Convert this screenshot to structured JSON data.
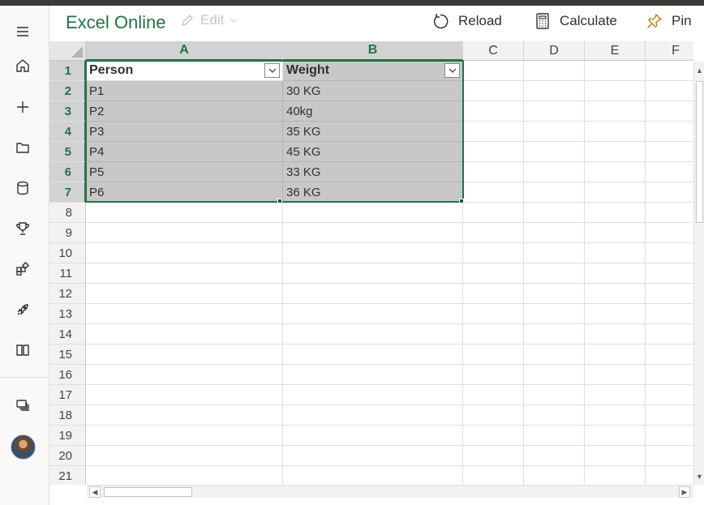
{
  "app": {
    "title": "Excel Online",
    "edit_label": "Edit"
  },
  "toolbar": {
    "reload_label": "Reload",
    "calculate_label": "Calculate",
    "pin_label": "Pin"
  },
  "rail": {
    "items": [
      {
        "name": "menu-icon"
      },
      {
        "name": "home-icon"
      },
      {
        "name": "new-icon"
      },
      {
        "name": "folder-icon"
      },
      {
        "name": "database-icon"
      },
      {
        "name": "trophy-icon"
      },
      {
        "name": "apps-icon"
      },
      {
        "name": "rocket-icon"
      },
      {
        "name": "book-icon"
      },
      {
        "name": "chat-icon"
      }
    ]
  },
  "grid": {
    "columns": [
      "A",
      "B",
      "C",
      "D",
      "E",
      "F"
    ],
    "rows": [
      "1",
      "2",
      "3",
      "4",
      "5",
      "6",
      "7",
      "8",
      "9",
      "10",
      "11",
      "12",
      "13",
      "14",
      "15",
      "16",
      "17",
      "18",
      "19",
      "20",
      "21"
    ],
    "table": [
      [
        "Person",
        "Weight"
      ],
      [
        "P1",
        "30 KG"
      ],
      [
        "P2",
        "40kg"
      ],
      [
        "P3",
        "35 KG"
      ],
      [
        "P4",
        "45 KG"
      ],
      [
        "P5",
        "33 KG"
      ],
      [
        "P6",
        "36 KG"
      ]
    ]
  },
  "colors": {
    "accent": "#217346",
    "selection": "#c8c8c8"
  }
}
